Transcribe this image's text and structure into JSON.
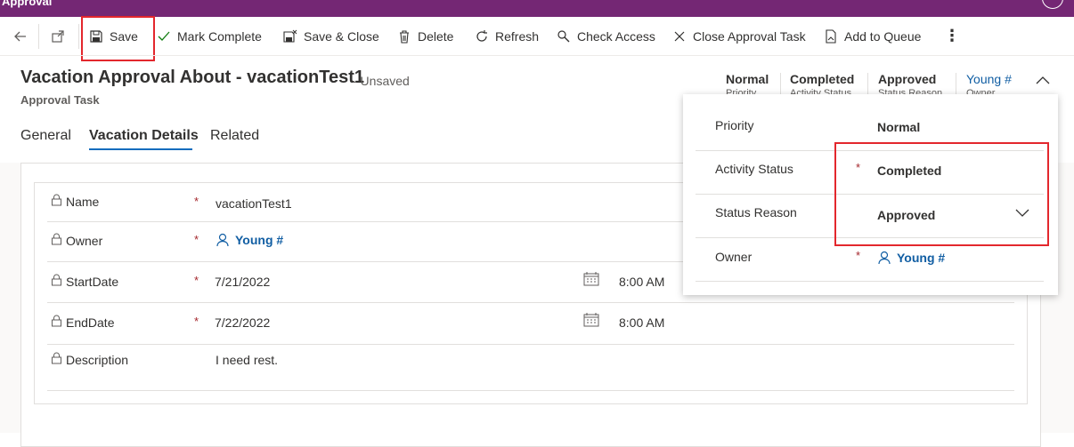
{
  "app": {
    "title": "Approval"
  },
  "commands": {
    "save": "Save",
    "mark_complete": "Mark Complete",
    "save_close": "Save & Close",
    "delete": "Delete",
    "refresh": "Refresh",
    "check_access": "Check Access",
    "close_approval_task": "Close Approval Task",
    "add_to_queue": "Add to Queue"
  },
  "record": {
    "title": "Vacation Approval About - vacationTest1",
    "unsaved": "- Unsaved",
    "entity": "Approval Task"
  },
  "header_fields": [
    {
      "value": "Normal",
      "label": "Priority"
    },
    {
      "value": "Completed",
      "label": "Activity Status"
    },
    {
      "value": "Approved",
      "label": "Status Reason"
    },
    {
      "value": "Young #",
      "label": "Owner"
    }
  ],
  "tabs": [
    "General",
    "Vacation Details",
    "Related"
  ],
  "form": {
    "name": {
      "label": "Name",
      "value": "vacationTest1"
    },
    "owner": {
      "label": "Owner",
      "value": "Young #"
    },
    "start": {
      "label": "StartDate",
      "date": "7/21/2022",
      "time": "8:00 AM"
    },
    "end": {
      "label": "EndDate",
      "date": "7/22/2022",
      "time": "8:00 AM"
    },
    "description": {
      "label": "Description",
      "value": "I need rest."
    },
    "required_mark": "*"
  },
  "flyout": {
    "priority": {
      "label": "Priority",
      "value": "Normal"
    },
    "activity_status": {
      "label": "Activity Status",
      "value": "Completed"
    },
    "status_reason": {
      "label": "Status Reason",
      "value": "Approved"
    },
    "owner": {
      "label": "Owner",
      "value": "Young #"
    }
  },
  "colors": {
    "brand": "#742774",
    "accent": "#0f6cbd",
    "highlight": "#e3272d",
    "required": "#a4262c"
  }
}
